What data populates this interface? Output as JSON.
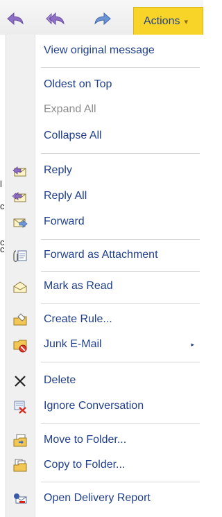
{
  "toolbar": {
    "reply_icon": "reply-arrow-icon",
    "reply_all_icon": "reply-all-arrow-icon",
    "forward_icon": "forward-arrow-icon",
    "actions_label": "Actions",
    "actions_caret": "▾",
    "accent_color": "#f9d428"
  },
  "menu": {
    "items": [
      {
        "label": "View original message"
      },
      {
        "label": "Oldest on Top"
      },
      {
        "label": "Expand All",
        "disabled": true
      },
      {
        "label": "Collapse All"
      },
      {
        "label": "Reply",
        "icon": "reply-envelope-icon"
      },
      {
        "label": "Reply All",
        "icon": "reply-all-envelope-icon"
      },
      {
        "label": "Forward",
        "icon": "forward-envelope-icon"
      },
      {
        "label": "Forward as Attachment",
        "icon": "attachment-icon"
      },
      {
        "label": "Mark as Read",
        "icon": "open-envelope-icon"
      },
      {
        "label": "Create Rule...",
        "icon": "rule-folder-icon"
      },
      {
        "label": "Junk E-Mail",
        "icon": "junk-folder-icon",
        "submenu_arrow": "▸"
      },
      {
        "label": "Delete",
        "icon": "delete-x-icon"
      },
      {
        "label": "Ignore Conversation",
        "icon": "ignore-icon"
      },
      {
        "label": "Move to Folder...",
        "icon": "move-folder-icon"
      },
      {
        "label": "Copy to Folder...",
        "icon": "copy-folder-icon"
      },
      {
        "label": "Open Delivery Report",
        "icon": "delivery-report-icon"
      }
    ]
  },
  "edge_fragments": [
    "l",
    "c",
    "c",
    "c"
  ]
}
